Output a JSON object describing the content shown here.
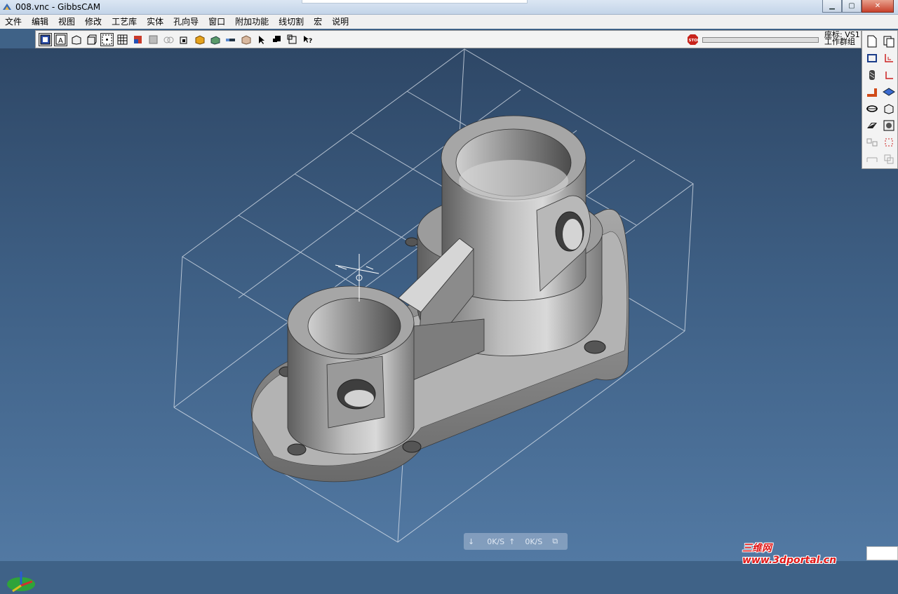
{
  "window": {
    "title": "008.vnc - GibbsCAM",
    "app_icon": "gibbscam-app-icon",
    "controls": [
      "minimize-icon",
      "maximize-icon",
      "close-icon"
    ]
  },
  "menu": {
    "items": [
      "文件",
      "编辑",
      "视图",
      "修改",
      "工艺库",
      "实体",
      "孔向导",
      "窗口",
      "附加功能",
      "线切割",
      "宏",
      "说明"
    ]
  },
  "toolbar": {
    "icons": [
      "view-frame-icon",
      "view-text-icon",
      "view-iso-icon",
      "view-box-icon",
      "view-center-icon",
      "grid-icon",
      "shade-color-icon",
      "shade-gray-icon",
      "circle-pair-icon",
      "solid-cube-icon",
      "solid-yellow-icon",
      "solid-green-icon",
      "tool-bar-icon",
      "stack-icon",
      "select-arrow-icon",
      "cursor-dropdown-icon",
      "box-dropdown-icon",
      "help-cursor-icon"
    ],
    "stop_icon": "stop-icon",
    "coord_line1": "座标: VS1",
    "coord_line2": "工作群组"
  },
  "right_panel": {
    "icons": [
      "new-doc-icon",
      "copy-doc-icon",
      "rect-select-icon",
      "axis-xy-icon",
      "mill-tool-icon",
      "axis-corner-icon",
      "pipe-icon",
      "plane-icon",
      "lathe-icon",
      "cube-icon",
      "surface-icon",
      "shaded-cube-icon",
      "flip-icon",
      "dim-icon",
      "flat-icon",
      "copy-icon"
    ]
  },
  "status": {
    "download_rate": "0K/S",
    "upload_rate": "0K/S"
  },
  "watermark": {
    "text": "三维网www.3dportal.cn"
  },
  "colors": {
    "viewport_top": "#2e4766",
    "viewport_bottom": "#5279a3",
    "part_gray": "#8a8a8a",
    "stock_box": "#dfe6ef",
    "menu_bg": "#f0f0f0",
    "watermark_red": "#e01818"
  }
}
